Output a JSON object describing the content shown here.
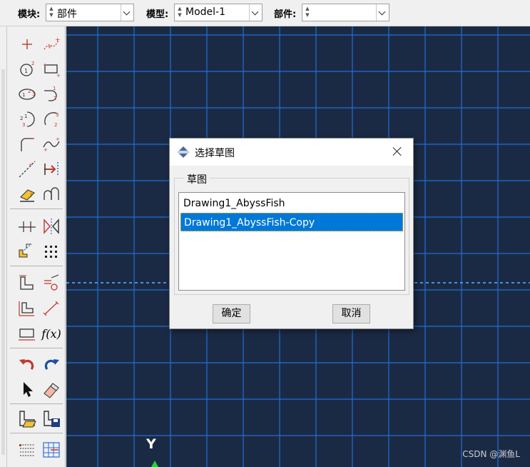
{
  "context_bar": {
    "module_label": "模块:",
    "module_value": "部件",
    "model_label": "模型:",
    "model_value": "Model-1",
    "part_label": "部件:",
    "part_value": ""
  },
  "toolbox": {
    "text_tool_label": "f(x)"
  },
  "viewport": {
    "axis_label": "Y",
    "watermark": "CSDN @渊鱼L",
    "background_color": "#1b2a44",
    "grid_color": "#1f6fd6"
  },
  "dialog": {
    "title": "选择草图",
    "group_label": "草图",
    "items": [
      {
        "label": "Drawing1_AbyssFish",
        "selected": false
      },
      {
        "label": "Drawing1_AbyssFish-Copy",
        "selected": true
      }
    ],
    "ok_label": "确定",
    "cancel_label": "取消",
    "selection_color": "#0078d7"
  }
}
